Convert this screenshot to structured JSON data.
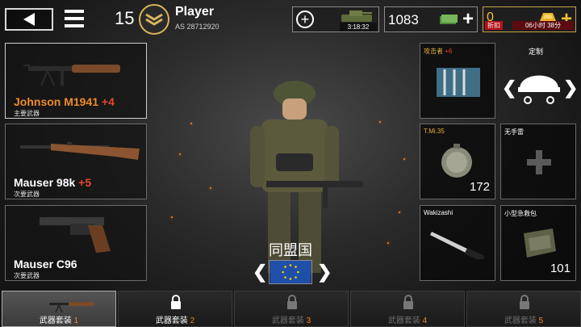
{
  "header": {
    "level": "15",
    "player_name": "Player",
    "player_id": "AS 28712920",
    "supply_timer": "3:18:32",
    "money": "1083",
    "gold": "0",
    "discount_label": "折扣",
    "discount_time": "06小时 38分"
  },
  "weapons": [
    {
      "name": "Johnson M1941",
      "bonus": "+4",
      "slot": "主要武器"
    },
    {
      "name": "Mauser 98k",
      "bonus": "+5",
      "slot": "次要武器"
    },
    {
      "name": "Mauser C96",
      "bonus": "",
      "slot": "次要武器"
    }
  ],
  "items": {
    "medal": {
      "label": "攻击者",
      "bonus": "+6"
    },
    "custom": {
      "label": "定制"
    },
    "mine": {
      "label": "T.Mi.35",
      "count": "172"
    },
    "grenade": {
      "label": "无手雷"
    },
    "melee": {
      "label": "Wakizashi"
    },
    "medkit": {
      "label": "小型急救包",
      "count": "101"
    }
  },
  "faction": {
    "name": "同盟国"
  },
  "loadouts": [
    {
      "label": "武器套装",
      "num": "1"
    },
    {
      "label": "武器套装",
      "num": "2"
    },
    {
      "label": "武器套装",
      "num": "3"
    },
    {
      "label": "武器套装",
      "num": "4"
    },
    {
      "label": "武器套装",
      "num": "5"
    }
  ],
  "colors": {
    "accent_orange": "#f08a2a",
    "gold": "#f5c13b",
    "discount_red": "#b3121a"
  }
}
